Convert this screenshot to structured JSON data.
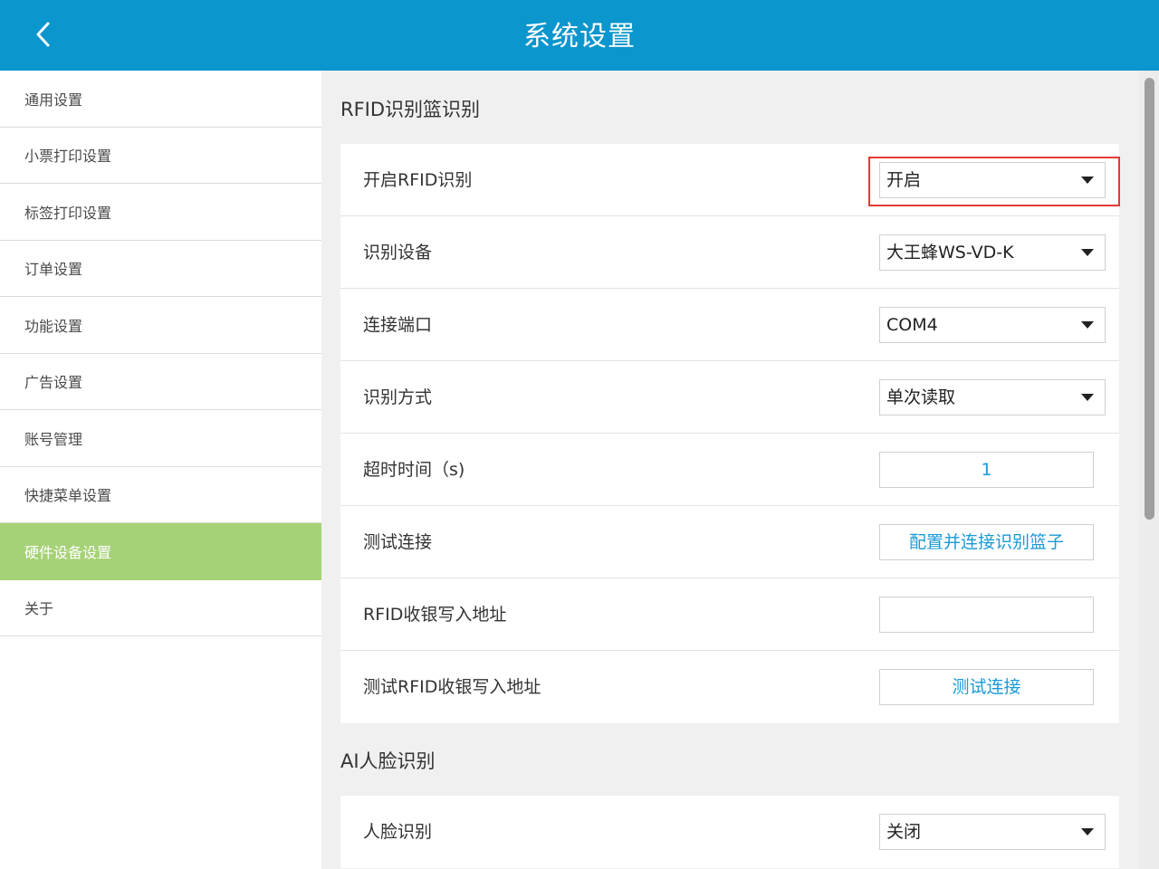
{
  "header": {
    "title": "系统设置",
    "back_icon": "chevron-left-icon"
  },
  "sidebar": {
    "items": [
      {
        "label": "通用设置"
      },
      {
        "label": "小票打印设置"
      },
      {
        "label": "标签打印设置"
      },
      {
        "label": "订单设置"
      },
      {
        "label": "功能设置"
      },
      {
        "label": "广告设置"
      },
      {
        "label": "账号管理"
      },
      {
        "label": "快捷菜单设置"
      },
      {
        "label": "硬件设备设置",
        "active": true
      },
      {
        "label": "关于"
      }
    ]
  },
  "rfid_section": {
    "title": "RFID识别篮识别",
    "rows": {
      "enable": {
        "label": "开启RFID识别",
        "value": "开启"
      },
      "device": {
        "label": "识别设备",
        "value": "大王蜂WS-VD-K"
      },
      "port": {
        "label": "连接端口",
        "value": "COM4"
      },
      "mode": {
        "label": "识别方式",
        "value": "单次读取"
      },
      "timeout": {
        "label": "超时时间（s)",
        "value": "1"
      },
      "test_connection": {
        "label": "测试连接",
        "button": "配置并连接识别篮子"
      },
      "write_address": {
        "label": "RFID收银写入地址",
        "value": ""
      },
      "test_write": {
        "label": "测试RFID收银写入地址",
        "button": "测试连接"
      }
    }
  },
  "ai_section": {
    "title": "AI人脸识别",
    "rows": {
      "face": {
        "label": "人脸识别",
        "value": "关闭"
      }
    }
  },
  "colors": {
    "header": "#0b96cd",
    "active_item": "#a6d277",
    "link": "#1a9ad6",
    "highlight": "#e53935"
  }
}
